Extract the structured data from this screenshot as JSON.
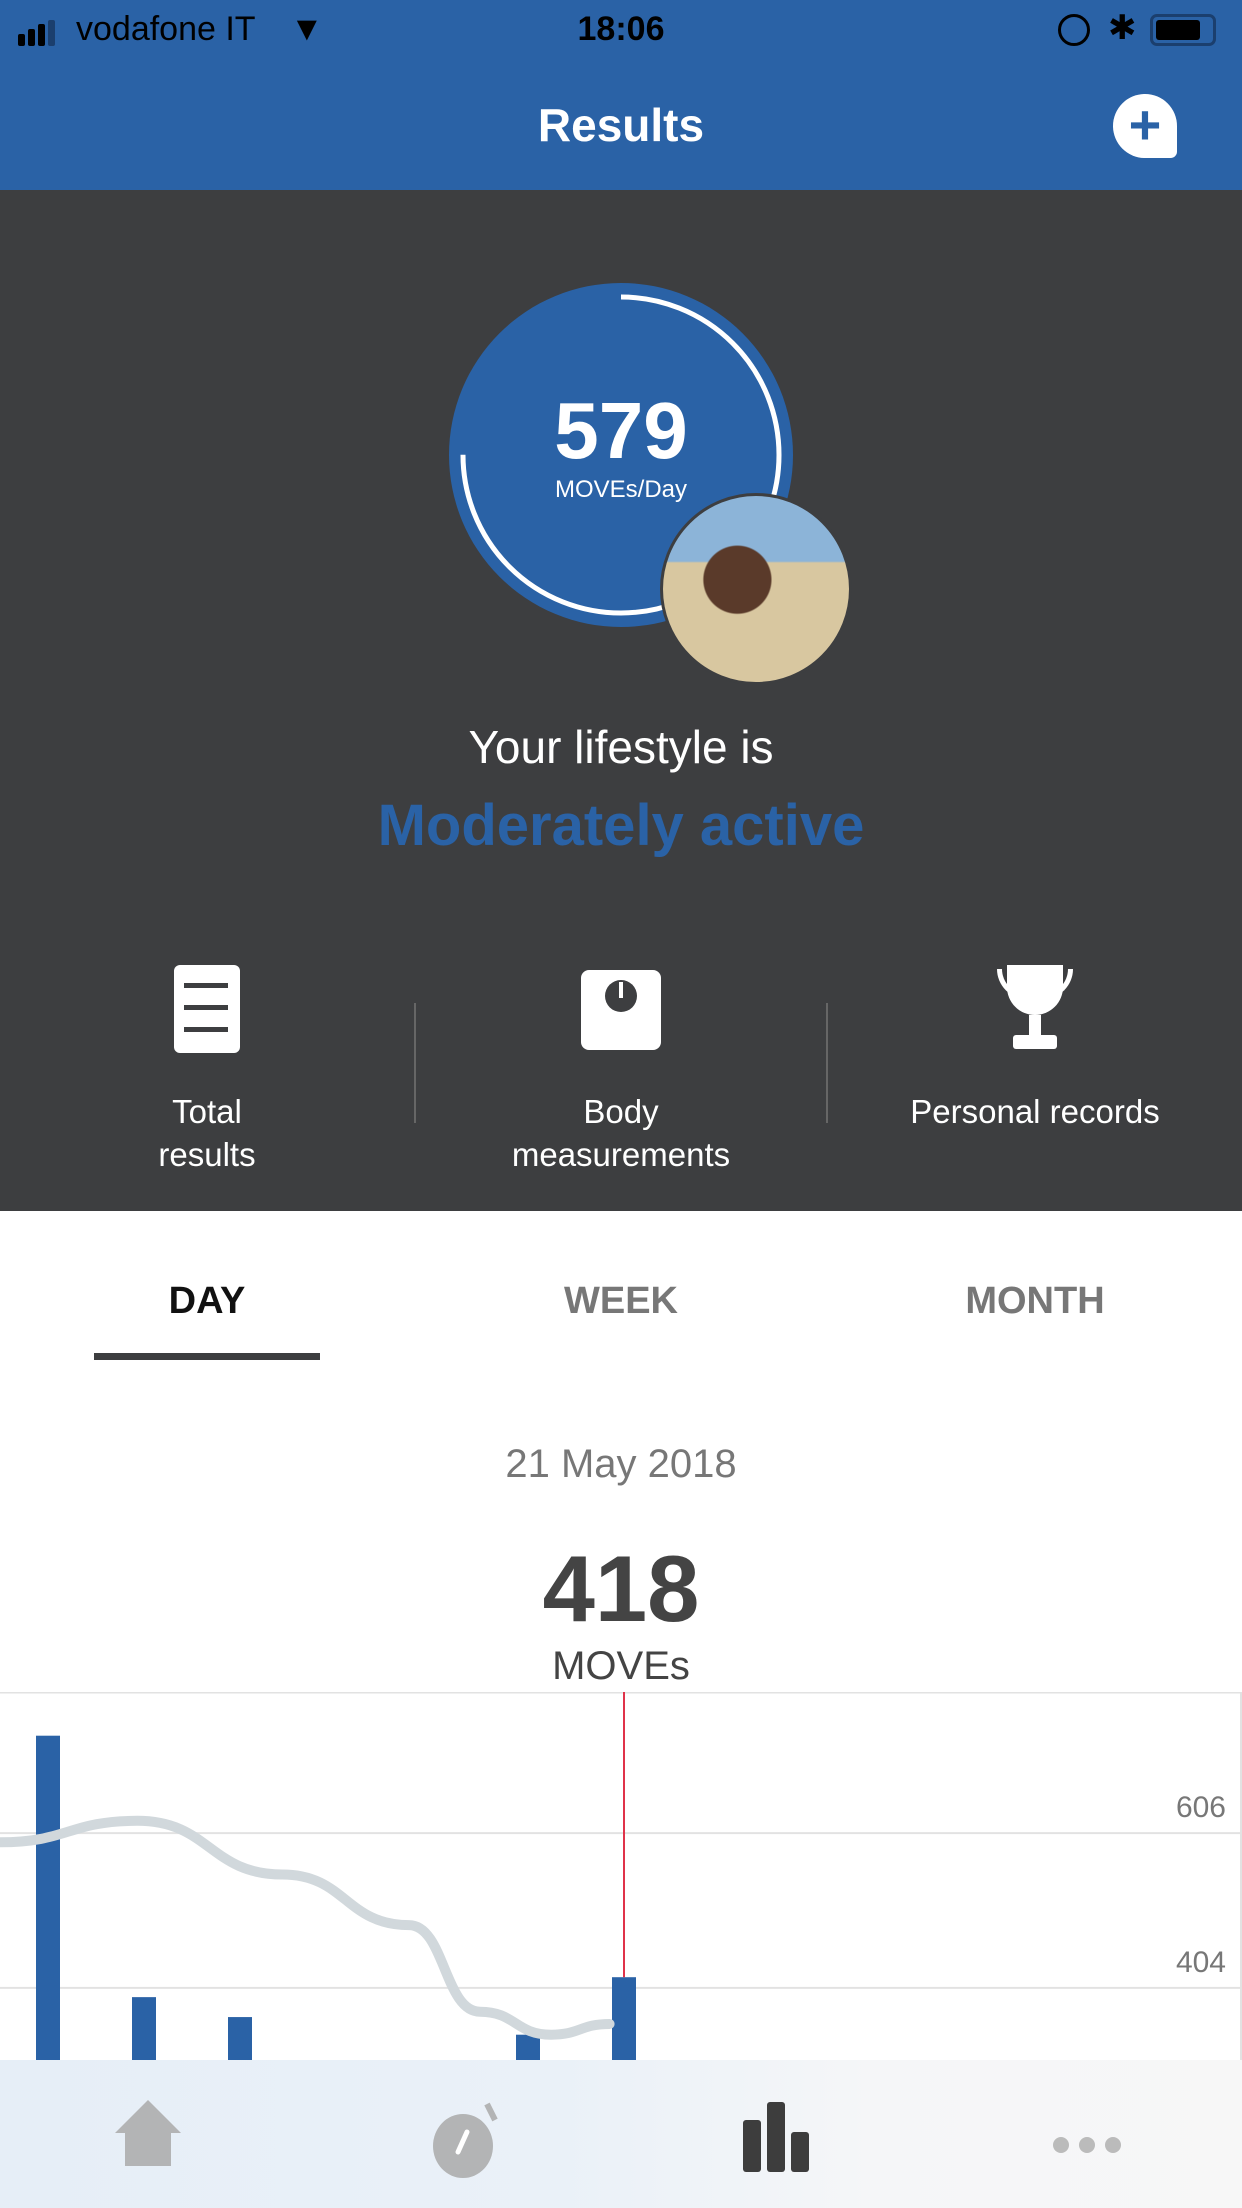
{
  "status_bar": {
    "carrier": "vodafone IT",
    "time": "18:06"
  },
  "nav": {
    "title": "Results",
    "add_icon": "plus-pin-icon"
  },
  "summary": {
    "value": "579",
    "unit": "MOVEs/Day",
    "lifestyle_prefix": "Your lifestyle is",
    "lifestyle": "Moderately active",
    "progress_fraction": 0.75
  },
  "shortcuts": [
    {
      "label_line1": "Total",
      "label_line2": "results",
      "icon": "list-icon"
    },
    {
      "label_line1": "Body",
      "label_line2": "measurements",
      "icon": "scale-icon"
    },
    {
      "label_line1": "Personal records",
      "label_line2": "",
      "icon": "trophy-icon"
    }
  ],
  "tabs": [
    {
      "label": "DAY",
      "active": true
    },
    {
      "label": "WEEK"
    },
    {
      "label": "MONTH"
    }
  ],
  "day": {
    "date": "21 May 2018",
    "value": "418",
    "unit": "MOVEs"
  },
  "colors": {
    "accent": "#2a62a6",
    "panel": "#3d3e40",
    "cursor": "#e0334a",
    "trend": "#d1d8dc"
  },
  "chart_data": {
    "type": "bar",
    "ylim": [
      310,
      790
    ],
    "y_ticks": [
      606,
      404
    ],
    "grid": true,
    "bars": [
      {
        "x": 0,
        "value": 733
      },
      {
        "x": 1,
        "value": 392
      },
      {
        "x": 2,
        "value": 366
      },
      {
        "x": 5,
        "value": 343
      },
      {
        "x": 6,
        "value": 418
      }
    ],
    "trend": [
      [
        -0.5,
        594
      ],
      [
        0.93,
        622
      ],
      [
        2.44,
        552
      ],
      [
        3.76,
        486
      ],
      [
        4.5,
        373
      ],
      [
        5.24,
        343
      ],
      [
        5.85,
        357
      ]
    ],
    "selected_x": 6
  },
  "tabbar": [
    {
      "icon": "home-icon"
    },
    {
      "icon": "stopwatch-icon"
    },
    {
      "icon": "results-chart-icon",
      "active": true
    },
    {
      "icon": "more-icon"
    }
  ]
}
